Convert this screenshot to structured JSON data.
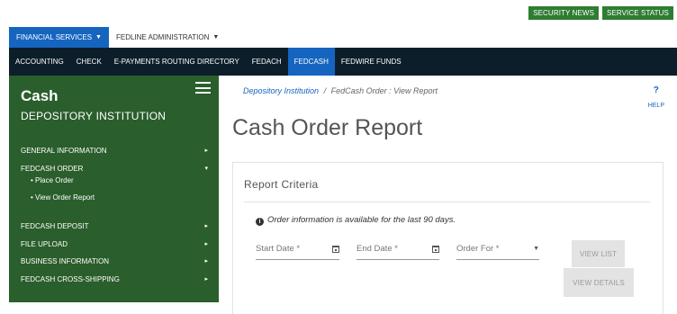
{
  "utility": {
    "security_news": "SECURITY NEWS",
    "service_status": "SERVICE STATUS"
  },
  "nav_primary": {
    "financial_services": "FINANCIAL SERVICES",
    "fedline_admin": "FEDLINE ADMINISTRATION"
  },
  "nav_secondary": {
    "items": [
      "ACCOUNTING",
      "CHECK",
      "E-PAYMENTS ROUTING DIRECTORY",
      "FEDACH",
      "FEDCASH",
      "FEDWIRE FUNDS"
    ],
    "active": "FEDCASH"
  },
  "sidebar": {
    "title": "Cash",
    "subtitle": "DEPOSITORY INSTITUTION",
    "general_information": "GENERAL INFORMATION",
    "fedcash_order": "FEDCASH ORDER",
    "place_order": "• Place Order",
    "view_order_report": "• View Order Report",
    "fedcash_deposit": "FEDCASH DEPOSIT",
    "file_upload": "FILE UPLOAD",
    "business_information": "BUSINESS INFORMATION",
    "fedcash_cross_shipping": "FEDCASH CROSS-SHIPPING"
  },
  "breadcrumb": {
    "parent": "Depository Institution",
    "separator": "/",
    "current": "FedCash Order : View Report"
  },
  "help": {
    "label": "HELP"
  },
  "page": {
    "title": "Cash Order Report"
  },
  "criteria": {
    "title": "Report  Criteria",
    "info": "Order information is available for the last 90 days.",
    "start_date": "Start Date *",
    "end_date": "End Date *",
    "order_for": "Order For *",
    "view_list": "VIEW LIST",
    "view_details": "VIEW DETAILS"
  },
  "colors": {
    "sidebar_green": "#2a5e2c",
    "utility_green": "#2e7d32",
    "nav_blue": "#1565c0",
    "nav_dark": "#0d1e2b"
  }
}
